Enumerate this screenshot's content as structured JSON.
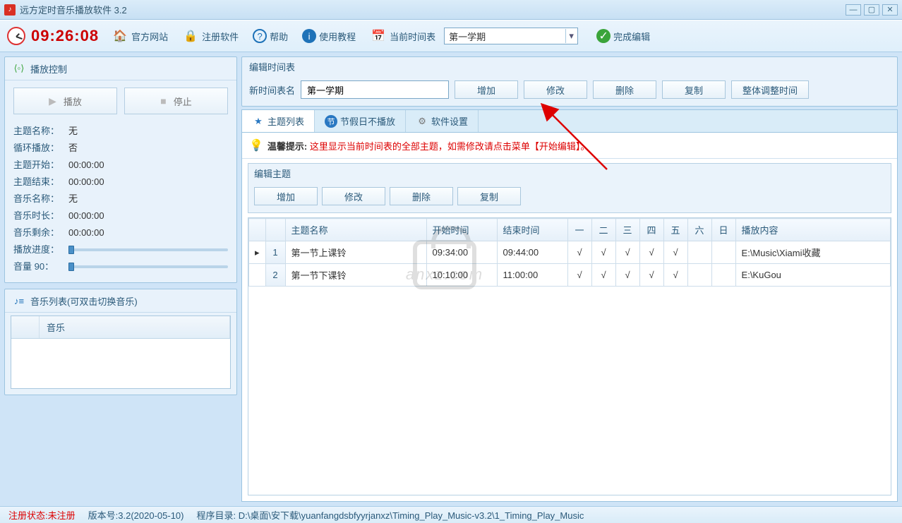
{
  "window": {
    "title": "远方定时音乐播放软件 3.2"
  },
  "toolbar": {
    "time": "09:26:08",
    "website": "官方网站",
    "register": "注册软件",
    "help": "帮助",
    "tutorial": "使用教程",
    "current_schedule_label": "当前时间表",
    "current_schedule_value": "第一学期",
    "finish_edit": "完成编辑"
  },
  "play_panel": {
    "title": "播放控制",
    "play_btn": "播放",
    "stop_btn": "停止",
    "rows": {
      "theme_name_lbl": "主题名称：",
      "theme_name_val": "无",
      "loop_lbl": "循环播放：",
      "loop_val": "否",
      "theme_start_lbl": "主题开始：",
      "theme_start_val": "00:00:00",
      "theme_end_lbl": "主题结束：",
      "theme_end_val": "00:00:00",
      "music_name_lbl": "音乐名称：",
      "music_name_val": "无",
      "music_len_lbl": "音乐时长：",
      "music_len_val": "00:00:00",
      "music_remain_lbl": "音乐剩余：",
      "music_remain_val": "00:00:00",
      "progress_lbl": "播放进度：",
      "volume_lbl": "音量 90："
    }
  },
  "music_list": {
    "title": "音乐列表(可双击切换音乐)",
    "col0": "",
    "col1": "音乐"
  },
  "edit_schedule": {
    "title": "编辑时间表",
    "name_label": "新时间表名",
    "name_value": "第一学期",
    "btn_add": "增加",
    "btn_modify": "修改",
    "btn_delete": "删除",
    "btn_copy": "复制",
    "btn_adjust": "整体调整时间"
  },
  "tabs": {
    "themes": "主题列表",
    "holidays": "节假日不播放",
    "settings": "软件设置"
  },
  "tip": {
    "prefix": "温馨提示: ",
    "text": "这里显示当前时间表的全部主题，如需修改请点击菜单【开始编辑】。"
  },
  "edit_theme": {
    "title": "编辑主题",
    "btn_add": "增加",
    "btn_modify": "修改",
    "btn_delete": "删除",
    "btn_copy": "复制"
  },
  "table": {
    "headers": {
      "name": "主题名称",
      "start": "开始时间",
      "end": "结束时间",
      "d1": "一",
      "d2": "二",
      "d3": "三",
      "d4": "四",
      "d5": "五",
      "d6": "六",
      "d7": "日",
      "content": "播放内容"
    },
    "rows": [
      {
        "num": "1",
        "name": "第一节上课铃",
        "start": "09:34:00",
        "end": "09:44:00",
        "days": [
          "√",
          "√",
          "√",
          "√",
          "√",
          "",
          ""
        ],
        "content": "E:\\Music\\Xiami收藏"
      },
      {
        "num": "2",
        "name": "第一节下课铃",
        "start": "10:10:00",
        "end": "11:00:00",
        "days": [
          "√",
          "√",
          "√",
          "√",
          "√",
          "",
          ""
        ],
        "content": "E:\\KuGou"
      }
    ]
  },
  "status": {
    "reg_label": "注册状态:",
    "reg_value": "未注册",
    "version_label": "版本号:",
    "version_value": "3.2(2020-05-10)",
    "path_label": "程序目录:",
    "path_value": "D:\\桌面\\安下载\\yuanfangdsbfyyrjanxz\\Timing_Play_Music-v3.2\\1_Timing_Play_Music"
  },
  "watermark": "anxz.com"
}
